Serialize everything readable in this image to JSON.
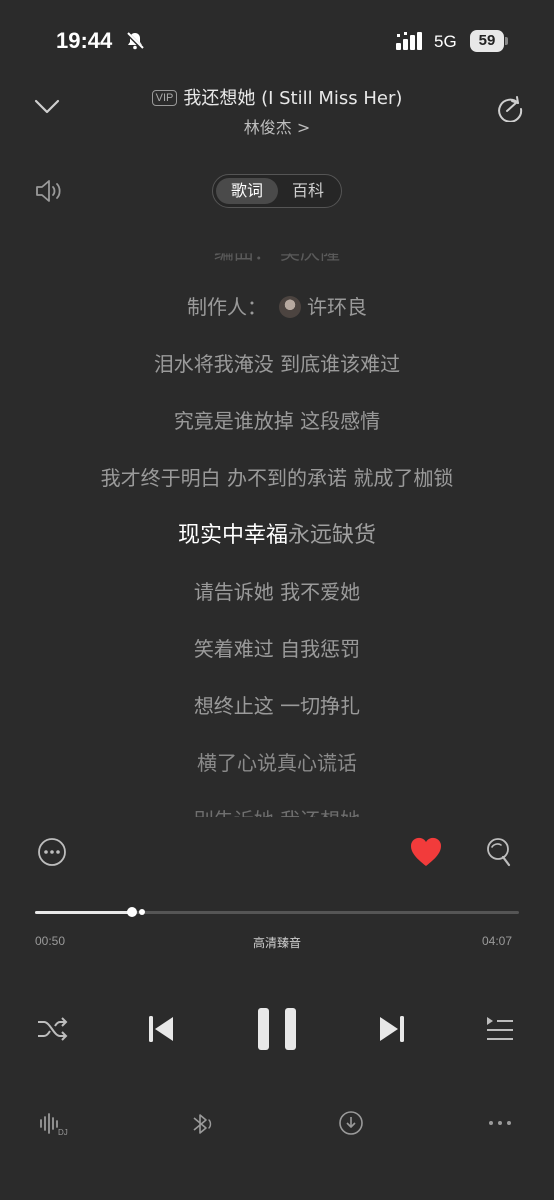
{
  "status_bar": {
    "time": "19:44",
    "network": "5G",
    "battery": "59"
  },
  "header": {
    "vip_badge": "VIP",
    "song_title": "我还想她 (I Still Miss Her)",
    "artist": "林俊杰 >"
  },
  "tabs": [
    {
      "label": "歌词",
      "active": true
    },
    {
      "label": "百科",
      "active": false
    }
  ],
  "lyrics": {
    "partial_top": "编曲：  吴庆隆",
    "producer_label": "制作人：",
    "producer_name": "许环良",
    "lines": [
      "泪水将我淹没 到底谁该难过",
      "究竟是谁放掉 这段感情",
      "我才终于明白 办不到的承诺 就成了枷锁"
    ],
    "current_sung": "现实中幸福",
    "current_rest": "永远缺货",
    "lines_after": [
      "请告诉她 我不爱她",
      "笑着难过 自我惩罚",
      "想终止这 一切挣扎",
      "横了心说真心谎话"
    ],
    "partial_bottom": "别告诉她 我还想她"
  },
  "actions": {
    "liked": true,
    "like_color": "#f23b3b"
  },
  "playback": {
    "elapsed": "00:50",
    "duration": "04:07",
    "quality": "高清臻音",
    "progress": 0.2
  },
  "icons": [
    "collapse-chevron-icon",
    "share-icon",
    "volume-icon",
    "more-circle-icon",
    "heart-icon",
    "comment-icon",
    "shuffle-icon",
    "previous-icon",
    "pause-icon",
    "next-icon",
    "playlist-icon",
    "sound-effect-icon",
    "bluetooth-icon",
    "download-icon",
    "more-icon"
  ]
}
